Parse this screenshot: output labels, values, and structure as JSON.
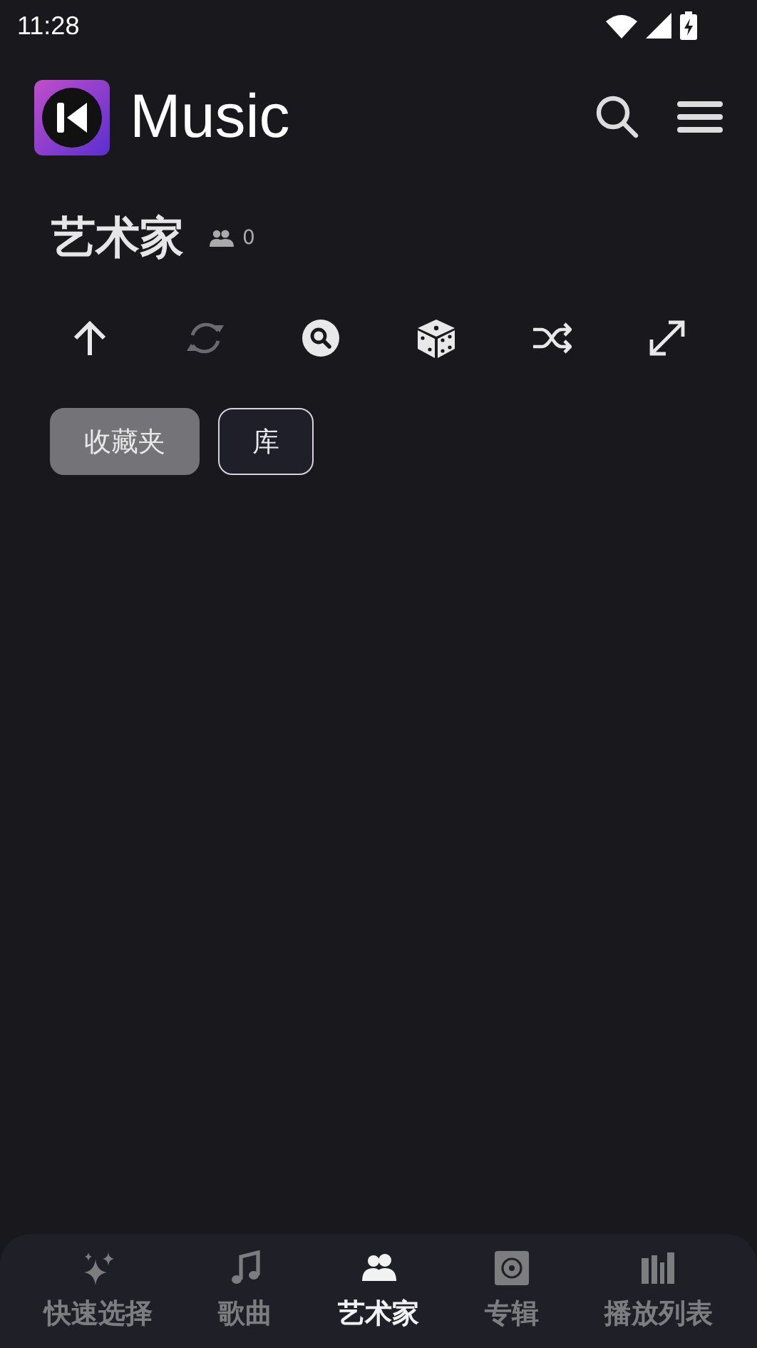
{
  "status_bar": {
    "time": "11:28"
  },
  "app_bar": {
    "title": "Music"
  },
  "heading": {
    "title": "艺术家",
    "count": "0"
  },
  "toolbar": [
    {
      "disabled": false
    },
    {
      "disabled": true
    },
    {
      "disabled": false
    },
    {
      "disabled": false
    },
    {
      "disabled": false
    },
    {
      "disabled": false
    }
  ],
  "chips": [
    {
      "label": "收藏夹",
      "selected": true
    },
    {
      "label": "库",
      "selected": false
    }
  ],
  "bottom_nav": [
    {
      "label": "快速选择",
      "selected": false
    },
    {
      "label": "歌曲",
      "selected": false
    },
    {
      "label": "艺术家",
      "selected": true
    },
    {
      "label": "专辑",
      "selected": false
    },
    {
      "label": "播放列表",
      "selected": false
    }
  ]
}
